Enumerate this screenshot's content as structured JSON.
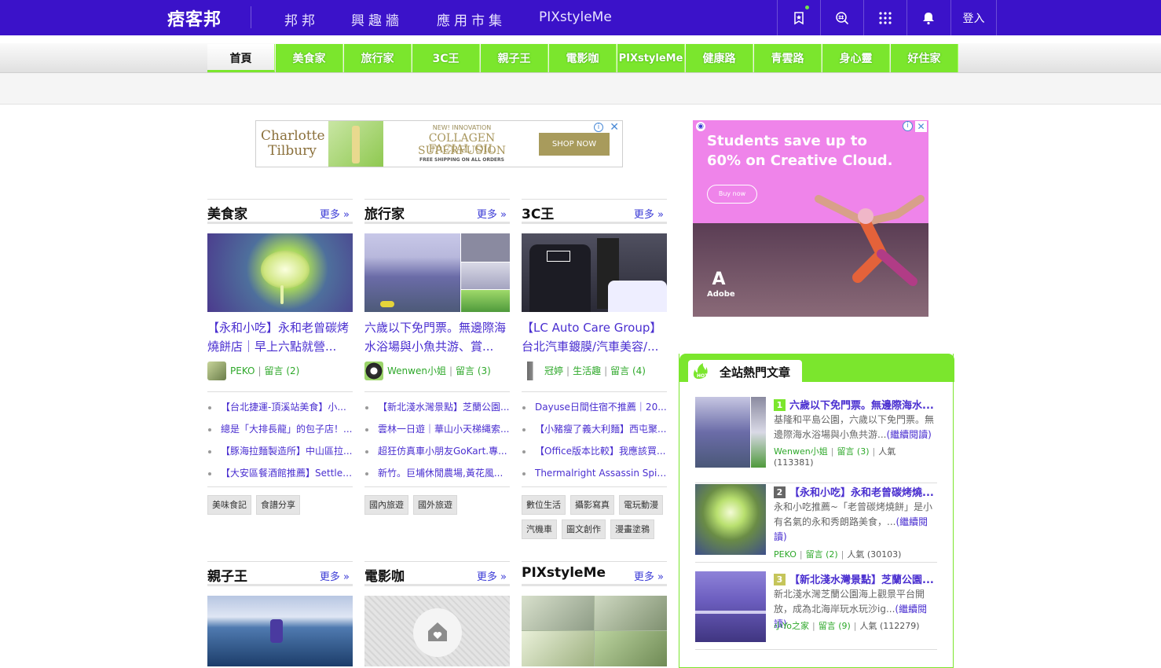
{
  "topbar": {
    "logo": "痞客邦",
    "links": [
      "邦邦",
      "興趣牆",
      "應用市集",
      "PIXstyleMe"
    ],
    "login": "登入",
    "icons": [
      "bookmark-star-icon",
      "search-hash-icon",
      "app-grid-icon",
      "bell-icon"
    ]
  },
  "colors": {
    "topbar": "#3b12c9",
    "accent_green": "#7be62d",
    "link_purple": "#4a2fd0",
    "meta_green": "#2ea82a"
  },
  "categories": [
    "首頁",
    "美食家",
    "旅行家",
    "3C王",
    "親子王",
    "電影咖",
    "PIXstyleMe",
    "健康路",
    "青雲路",
    "身心靈",
    "好住家"
  ],
  "ads": {
    "top": {
      "brand": "Charlotte Tilbury",
      "line1": "NEW! INNOVATION",
      "line2": "COLLAGEN SUPERFUSION",
      "line3": "FACIAL OIL",
      "line4": "FREE SHIPPING ON ALL ORDERS",
      "cta": "SHOP NOW"
    },
    "side": {
      "headline": "Students save up to 60% on Creative Cloud.",
      "cta": "Buy now",
      "brand": "Adobe"
    }
  },
  "sections": [
    {
      "title": "美食家",
      "more": "更多 »",
      "article": {
        "title": "【永和小吃】永和老曾碳烤燒餅店｜早上六點就營...",
        "author": "PEKO",
        "comments": "留言 (2)"
      },
      "links": [
        "【台北捷運-頂溪站美食】小...",
        "總是「大排長龍」的包子店！...",
        "【豚海拉麵製造所】中山區拉...",
        "【大安區餐酒館推薦】Settle ..."
      ],
      "tags": [
        "美味食記",
        "食譜分享"
      ]
    },
    {
      "title": "旅行家",
      "more": "更多 »",
      "article": {
        "title": "六歲以下免門票。無邊際海水浴場與小魚共游、賞...",
        "author": "Wenwen小姐",
        "comments": "留言 (3)"
      },
      "links": [
        "【新北淺水灣景點】芝蘭公園...",
        "雲林一日遊｜華山小天梯縄索...",
        "超狂仿真車小朋友GoKart.專...",
        "新竹。巨埔休閒農場,黃花風..."
      ],
      "tags": [
        "國內旅遊",
        "國外旅遊"
      ]
    },
    {
      "title": "3C王",
      "more": "更多 »",
      "article": {
        "title": "【LC Auto Care Group】台北汽車鍍膜/汽車美容/...",
        "author": "冠婷",
        "category": "生活趣",
        "comments": "留言 (4)"
      },
      "links": [
        "Dayuse日間住宿不推薦｜20...",
        "【小豬瘦了義大利麵】西屯聚...",
        "【Office版本比較】我應該買...",
        "Thermalright Assassin Spirit ..."
      ],
      "tags": [
        "數位生活",
        "攝影寫真",
        "電玩動漫",
        "汽機車",
        "圖文創作",
        "漫畫塗鴉"
      ]
    },
    {
      "title": "親子王",
      "more": "更多 »"
    },
    {
      "title": "電影咖",
      "more": "更多 »"
    },
    {
      "title": "PIXstyleMe",
      "more": "更多 »"
    }
  ],
  "hot": {
    "title": "全站熱門文章",
    "badge": "HOT",
    "items": [
      {
        "rank": "1",
        "title": "六歲以下免門票。無邊際海水...",
        "desc": "基隆和平島公園，六歲以下免門票。無邊際海水浴場與小魚共游...",
        "read_more": "(繼續閱讀)",
        "author": "Wenwen小姐",
        "comments": "留言 (3)",
        "views": "人氣 (113381)"
      },
      {
        "rank": "2",
        "title": "【永和小吃】永和老曾碳烤燒...",
        "desc": "永和小吃推薦~「老曾碳烤燒餅」是小有名氣的永和秀朗路美食，...",
        "read_more": "(繼續閱讀)",
        "author": "PEKO",
        "comments": "留言 (2)",
        "views": "人氣 (30103)"
      },
      {
        "rank": "3",
        "title": "【新北淺水灣景點】芝蘭公園...",
        "desc": "新北淺水灣芝蘭公園海上觀景平台開放，成為北海岸玩水玩沙ig...",
        "read_more": "(繼續閱讀)",
        "author": "小Yo之家",
        "comments": "留言 (9)",
        "views": "人氣 (112279)"
      }
    ]
  }
}
